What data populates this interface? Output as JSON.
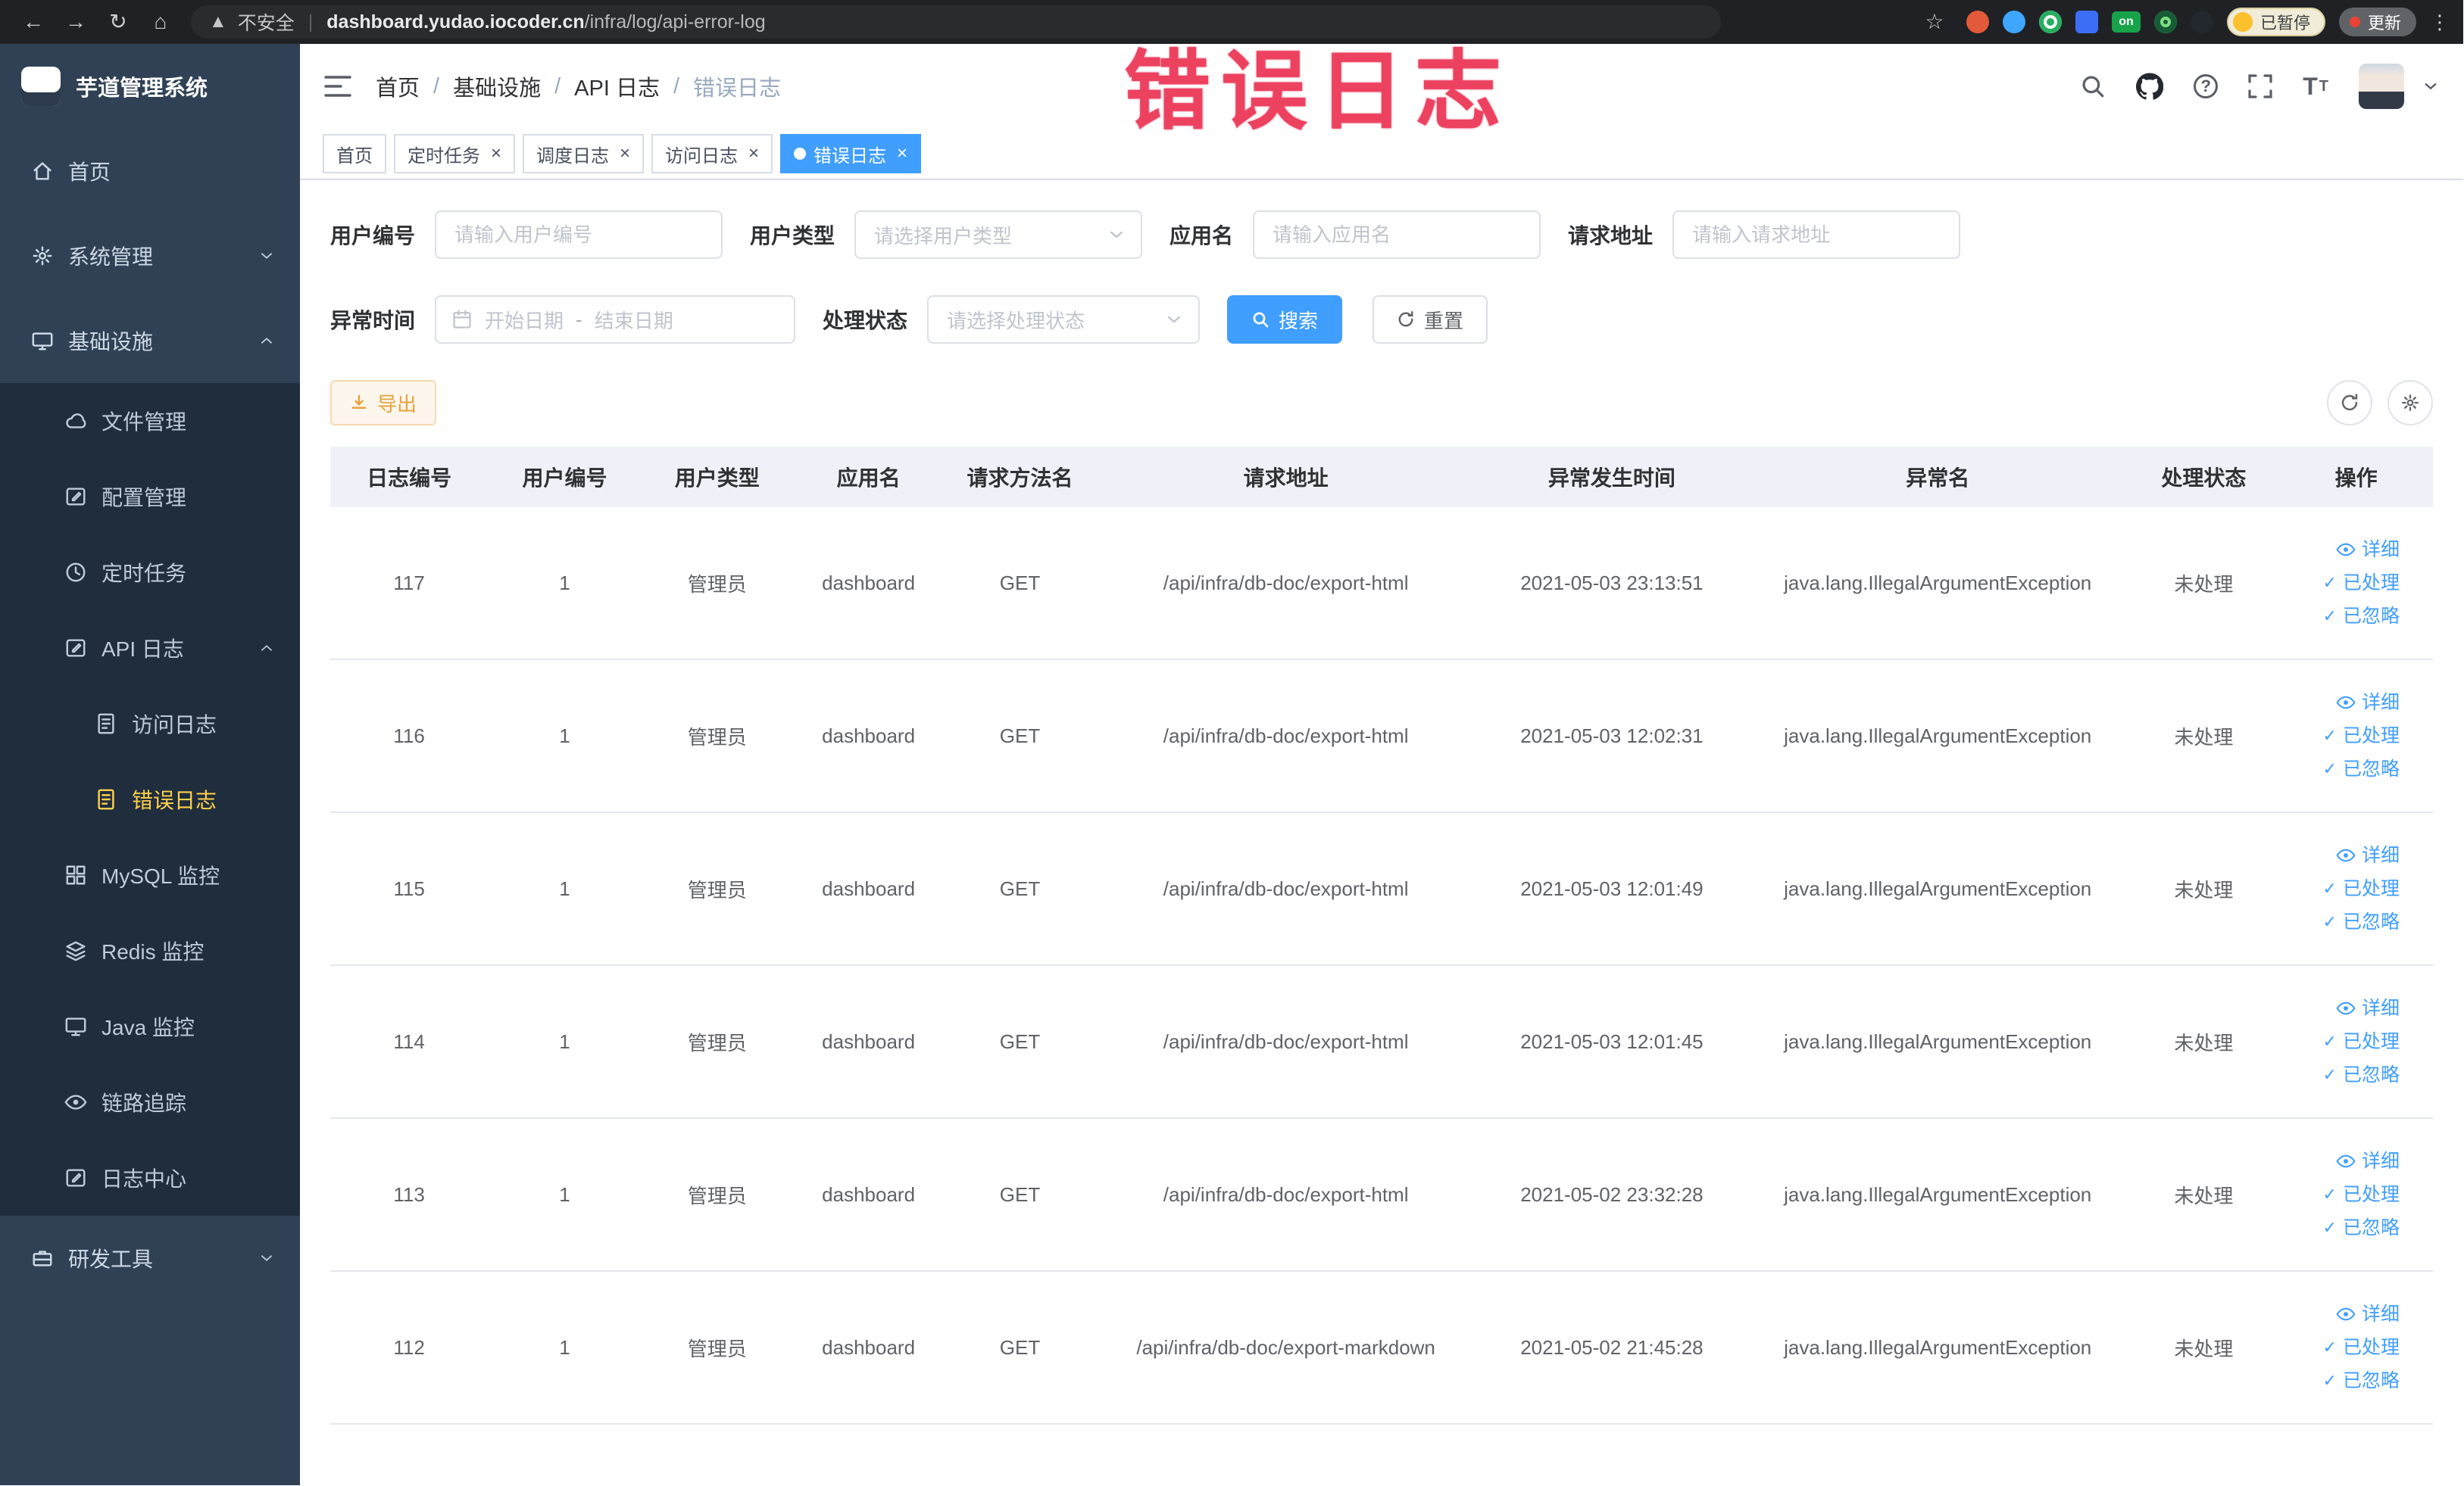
{
  "browser": {
    "security_label": "不安全",
    "domain": "dashboard.yudao.iocoder.cn",
    "path": "/infra/log/api-error-log",
    "paused_badge": "已暂停",
    "update_label": "更新",
    "on_badge": "on"
  },
  "annotation": {
    "text": "错误日志"
  },
  "sidebar": {
    "title": "芋道管理系统",
    "items": [
      {
        "key": "home",
        "label": "首页",
        "icon": "home",
        "level": 0,
        "sub": false,
        "expandable": false,
        "expanded": false,
        "active": false
      },
      {
        "key": "system",
        "label": "系统管理",
        "icon": "gear",
        "level": 0,
        "sub": false,
        "expandable": true,
        "expanded": false,
        "active": false
      },
      {
        "key": "infra",
        "label": "基础设施",
        "icon": "monitor",
        "level": 0,
        "sub": false,
        "expandable": true,
        "expanded": true,
        "active": false
      },
      {
        "key": "file",
        "label": "文件管理",
        "icon": "cloud",
        "level": 1,
        "sub": true,
        "expandable": false,
        "expanded": false,
        "active": false
      },
      {
        "key": "config",
        "label": "配置管理",
        "icon": "edit",
        "level": 1,
        "sub": true,
        "expandable": false,
        "expanded": false,
        "active": false
      },
      {
        "key": "job",
        "label": "定时任务",
        "icon": "clock",
        "level": 1,
        "sub": true,
        "expandable": false,
        "expanded": false,
        "active": false
      },
      {
        "key": "api-log",
        "label": "API 日志",
        "icon": "edit",
        "level": 1,
        "sub": true,
        "expandable": true,
        "expanded": true,
        "active": false
      },
      {
        "key": "access-log",
        "label": "访问日志",
        "icon": "doc",
        "level": 2,
        "sub": true,
        "expandable": false,
        "expanded": false,
        "active": false
      },
      {
        "key": "error-log",
        "label": "错误日志",
        "icon": "doc",
        "level": 2,
        "sub": true,
        "expandable": false,
        "expanded": false,
        "active": true
      },
      {
        "key": "mysql",
        "label": "MySQL 监控",
        "icon": "grid",
        "level": 1,
        "sub": true,
        "expandable": false,
        "expanded": false,
        "active": false
      },
      {
        "key": "redis",
        "label": "Redis 监控",
        "icon": "layers",
        "level": 1,
        "sub": true,
        "expandable": false,
        "expanded": false,
        "active": false
      },
      {
        "key": "java",
        "label": "Java 监控",
        "icon": "screen",
        "level": 1,
        "sub": true,
        "expandable": false,
        "expanded": false,
        "active": false
      },
      {
        "key": "tracer",
        "label": "链路追踪",
        "icon": "eye",
        "level": 1,
        "sub": true,
        "expandable": false,
        "expanded": false,
        "active": false
      },
      {
        "key": "log-center",
        "label": "日志中心",
        "icon": "edit",
        "level": 1,
        "sub": true,
        "expandable": false,
        "expanded": false,
        "active": false
      },
      {
        "key": "dev-tools",
        "label": "研发工具",
        "icon": "tools",
        "level": 0,
        "sub": false,
        "expandable": true,
        "expanded": false,
        "active": false
      }
    ]
  },
  "header": {
    "breadcrumb": [
      {
        "label": "首页"
      },
      {
        "label": "基础设施"
      },
      {
        "label": "API 日志"
      },
      {
        "label": "错误日志"
      }
    ]
  },
  "tabs": [
    {
      "key": "home",
      "label": "首页",
      "closable": false,
      "active": false
    },
    {
      "key": "job",
      "label": "定时任务",
      "closable": true,
      "active": false
    },
    {
      "key": "job-log",
      "label": "调度日志",
      "closable": true,
      "active": false
    },
    {
      "key": "access-log",
      "label": "访问日志",
      "closable": true,
      "active": false
    },
    {
      "key": "error-log",
      "label": "错误日志",
      "closable": true,
      "active": true
    }
  ],
  "filters": {
    "user_id": {
      "label": "用户编号",
      "placeholder": "请输入用户编号"
    },
    "user_type": {
      "label": "用户类型",
      "placeholder": "请选择用户类型"
    },
    "app_name": {
      "label": "应用名",
      "placeholder": "请输入应用名"
    },
    "request_url": {
      "label": "请求地址",
      "placeholder": "请输入请求地址"
    },
    "exception_time": {
      "label": "异常时间",
      "start_placeholder": "开始日期",
      "separator": "-",
      "end_placeholder": "结束日期"
    },
    "process_status": {
      "label": "处理状态",
      "placeholder": "请选择处理状态"
    },
    "search_label": "搜索",
    "reset_label": "重置"
  },
  "toolbar": {
    "export_label": "导出"
  },
  "table": {
    "columns": [
      "日志编号",
      "用户编号",
      "用户类型",
      "应用名",
      "请求方法名",
      "请求地址",
      "异常发生时间",
      "异常名",
      "处理状态",
      "操作"
    ],
    "row_actions": [
      {
        "key": "detail",
        "label": "详细",
        "icon": "eye"
      },
      {
        "key": "processed",
        "label": "已处理",
        "icon": "check"
      },
      {
        "key": "ignored",
        "label": "已忽略",
        "icon": "check"
      }
    ],
    "rows": [
      {
        "id": "117",
        "user_id": "1",
        "user_type": "管理员",
        "app": "dashboard",
        "method": "GET",
        "url": "/api/infra/db-doc/export-html",
        "time": "2021-05-03 23:13:51",
        "exception": "java.lang.IllegalArgumentException",
        "status": "未处理"
      },
      {
        "id": "116",
        "user_id": "1",
        "user_type": "管理员",
        "app": "dashboard",
        "method": "GET",
        "url": "/api/infra/db-doc/export-html",
        "time": "2021-05-03 12:02:31",
        "exception": "java.lang.IllegalArgumentException",
        "status": "未处理"
      },
      {
        "id": "115",
        "user_id": "1",
        "user_type": "管理员",
        "app": "dashboard",
        "method": "GET",
        "url": "/api/infra/db-doc/export-html",
        "time": "2021-05-03 12:01:49",
        "exception": "java.lang.IllegalArgumentException",
        "status": "未处理"
      },
      {
        "id": "114",
        "user_id": "1",
        "user_type": "管理员",
        "app": "dashboard",
        "method": "GET",
        "url": "/api/infra/db-doc/export-html",
        "time": "2021-05-03 12:01:45",
        "exception": "java.lang.IllegalArgumentException",
        "status": "未处理"
      },
      {
        "id": "113",
        "user_id": "1",
        "user_type": "管理员",
        "app": "dashboard",
        "method": "GET",
        "url": "/api/infra/db-doc/export-html",
        "time": "2021-05-02 23:32:28",
        "exception": "java.lang.IllegalArgumentException",
        "status": "未处理"
      },
      {
        "id": "112",
        "user_id": "1",
        "user_type": "管理员",
        "app": "dashboard",
        "method": "GET",
        "url": "/api/infra/db-doc/export-markdown",
        "time": "2021-05-02 21:45:28",
        "exception": "java.lang.IllegalArgumentException",
        "status": "未处理"
      }
    ]
  },
  "colors": {
    "primary": "#409eff",
    "sidebar_bg": "#304156",
    "submenu_bg": "#1f2d3d",
    "active_menu_text": "#ffd04b",
    "warning": "#e6a23c",
    "annotation_red": "#ec4260"
  }
}
